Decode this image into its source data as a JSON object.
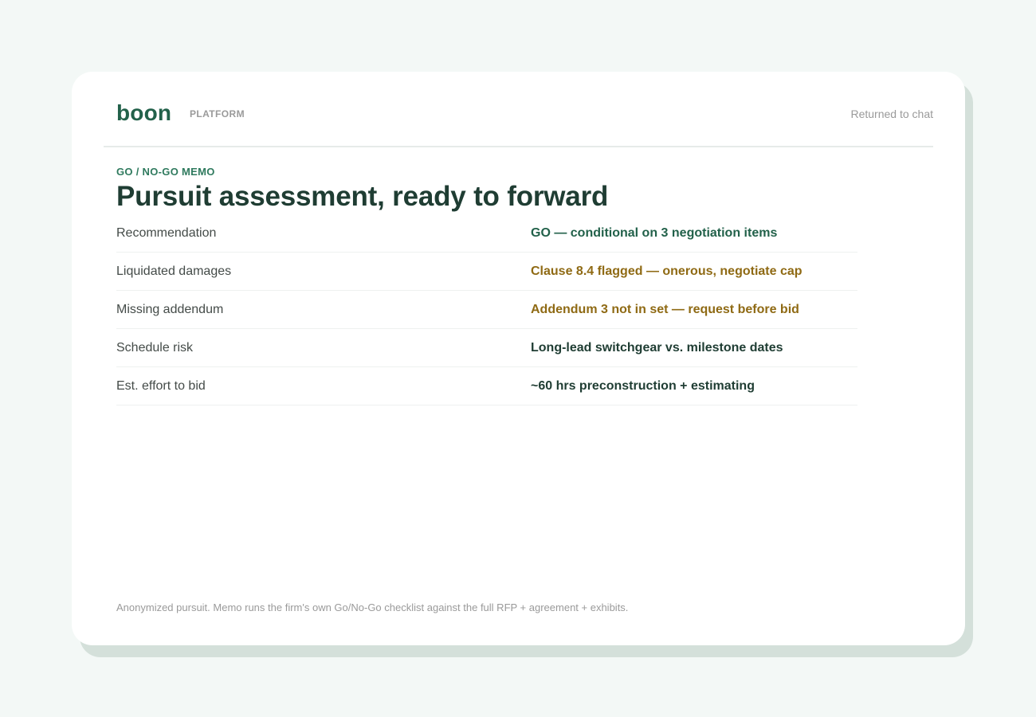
{
  "app": {
    "logo": "boon",
    "section": "PLATFORM",
    "status": "Returned to chat"
  },
  "memo": {
    "eyebrow": "GO / NO-GO MEMO",
    "title": "Pursuit assessment, ready to forward",
    "rows": [
      {
        "label": "Recommendation",
        "value": "GO — conditional on 3 negotiation items",
        "tone": "positive"
      },
      {
        "label": "Liquidated damages",
        "value": "Clause 8.4 flagged — onerous, negotiate cap",
        "tone": "warning"
      },
      {
        "label": "Missing addendum",
        "value": "Addendum 3 not in set — request before bid",
        "tone": "warning"
      },
      {
        "label": "Schedule risk",
        "value": "Long-lead switchgear vs. milestone dates",
        "tone": "neutral"
      },
      {
        "label": "Est. effort to bid",
        "value": "~60 hrs preconstruction + estimating",
        "tone": "neutral"
      }
    ],
    "footnote": "Anonymized pursuit. Memo runs the firm's own Go/No-Go checklist against the full RFP + agreement + exhibits."
  },
  "colors": {
    "positive": "#22614a",
    "warning": "#8f6a14",
    "neutral": "#1f3d33"
  }
}
